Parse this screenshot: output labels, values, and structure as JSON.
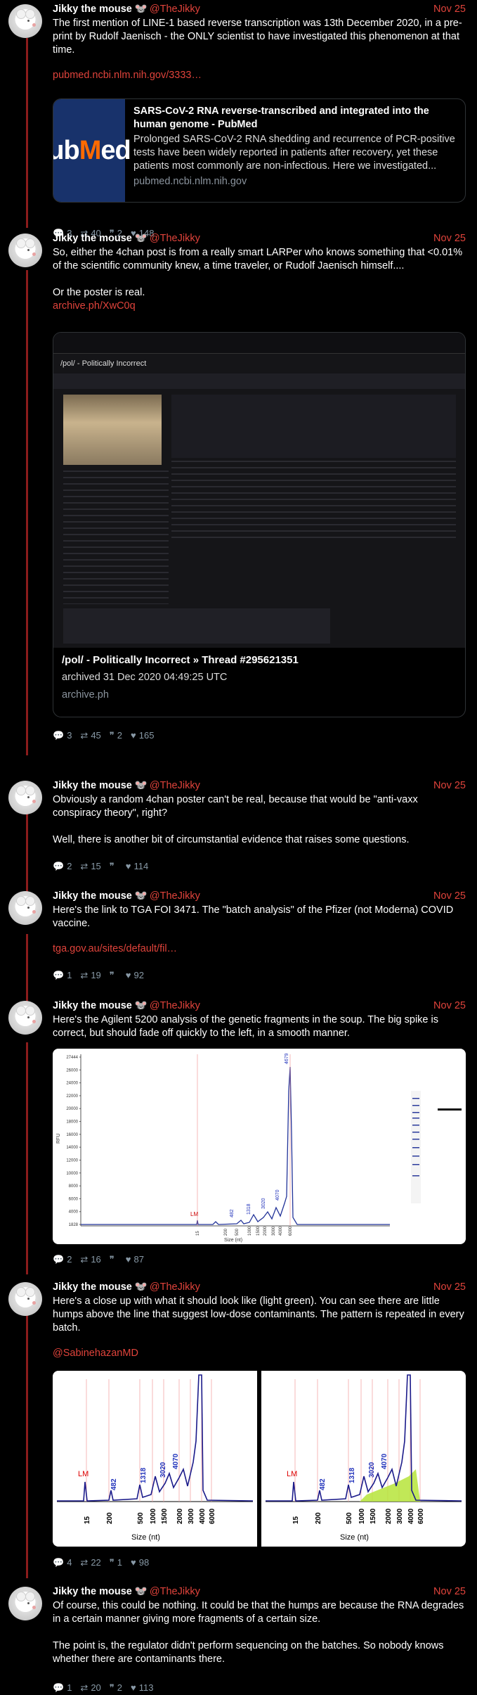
{
  "author": {
    "name": "Jikky the mouse",
    "handle": "@TheJikky",
    "emoji": "🐭"
  },
  "tweets": [
    {
      "date": "Nov 25",
      "text": [
        "The first mention of LINE-1 based reverse transcription was 13th December 2020, in a pre-print by Rudolf Jaenisch - the ONLY scientist to have investigated this phenomenon at that time."
      ],
      "link": "pubmed.ncbi.nlm.nih.gov/3333…",
      "card": {
        "thumb_text": "ubMed",
        "title": "SARS-CoV-2 RNA reverse-transcribed and integrated into the human genome - PubMed",
        "desc": "Prolonged SARS-CoV-2 RNA shedding and recurrence of PCR-positive tests have been widely reported in patients after recovery, yet these patients most commonly are non-infectious. Here we investigated...",
        "site": "pubmed.ncbi.nlm.nih.gov"
      },
      "stats": {
        "replies": "3",
        "retweets": "40",
        "quotes": "2",
        "likes": "148"
      }
    },
    {
      "date": "Nov 25",
      "text": [
        "So, either the 4chan post is from a really smart LARPer who knows something that <0.01% of the scientific community knew, a time traveler, or Rudolf Jaenisch himself....",
        "",
        "Or the poster is real."
      ],
      "link": "archive.ph/XwC0q",
      "card": {
        "board_title": "/pol/ - Politically Incorrect",
        "title": "/pol/ - Politically Incorrect » Thread #295621351",
        "desc": "archived 31 Dec 2020 04:49:25 UTC",
        "site": "archive.ph"
      },
      "stats": {
        "replies": "3",
        "retweets": "45",
        "quotes": "2",
        "likes": "165"
      }
    },
    {
      "date": "Nov 25",
      "text": [
        "Obviously a random 4chan poster can't be real, because that would be \"anti-vaxx conspiracy theory\", right?",
        "",
        "Well, there is another bit of circumstantial evidence that raises some questions."
      ],
      "stats": {
        "replies": "2",
        "retweets": "15",
        "quotes": "",
        "likes": "114"
      }
    },
    {
      "date": "Nov 25",
      "text": [
        "Here's the link to TGA FOI 3471. The \"batch analysis\" of the Pfizer (not Moderna) COVID vaccine."
      ],
      "link": "tga.gov.au/sites/default/fil…",
      "stats": {
        "replies": "1",
        "retweets": "19",
        "quotes": "",
        "likes": "92"
      }
    },
    {
      "date": "Nov 25",
      "text": [
        "Here's the Agilent 5200 analysis of the genetic fragments in the soup. The big spike is correct, but should fade off quickly to the left, in a smooth manner."
      ],
      "chart": {
        "ylabel": "RFU",
        "xlabel": "Size (nt)",
        "yticks": [
          "27444",
          "26000",
          "24000",
          "22000",
          "20000",
          "18000",
          "16000",
          "14000",
          "12000",
          "10000",
          "8000",
          "6000",
          "4000",
          "1828"
        ],
        "xticks": [
          "15",
          "200",
          "500",
          "1000",
          "1500",
          "2000",
          "3000",
          "4000",
          "6000"
        ],
        "peaks": [
          "LM",
          "482",
          "1318",
          "3020",
          "4070",
          "4679"
        ]
      },
      "stats": {
        "replies": "2",
        "retweets": "16",
        "quotes": "",
        "likes": "87"
      }
    },
    {
      "date": "Nov 25",
      "text": [
        "Here's a close up with what it should look like (light green). You can see there are little humps above the line that suggest low-dose contaminants. The pattern is repeated in every batch."
      ],
      "mention": "@SabinehazanMD",
      "closeup": {
        "xlabel": "Size (nt)",
        "peaks": [
          "LM",
          "482",
          "1318",
          "3020",
          "4070"
        ],
        "xticks": [
          "15",
          "200",
          "500",
          "1000",
          "1500",
          "2000",
          "3000",
          "4000",
          "6000"
        ]
      },
      "stats": {
        "replies": "4",
        "retweets": "22",
        "quotes": "1",
        "likes": "98"
      }
    },
    {
      "date": "Nov 25",
      "text": [
        "Of course, this could be nothing. It could be that the humps are because the RNA degrades in a certain manner giving more fragments of a certain size.",
        "",
        "The point is, the regulator didn't perform sequencing on the batches. So nobody knows whether there are contaminants there."
      ],
      "stats": {
        "replies": "1",
        "retweets": "20",
        "quotes": "2",
        "likes": "113"
      }
    }
  ]
}
